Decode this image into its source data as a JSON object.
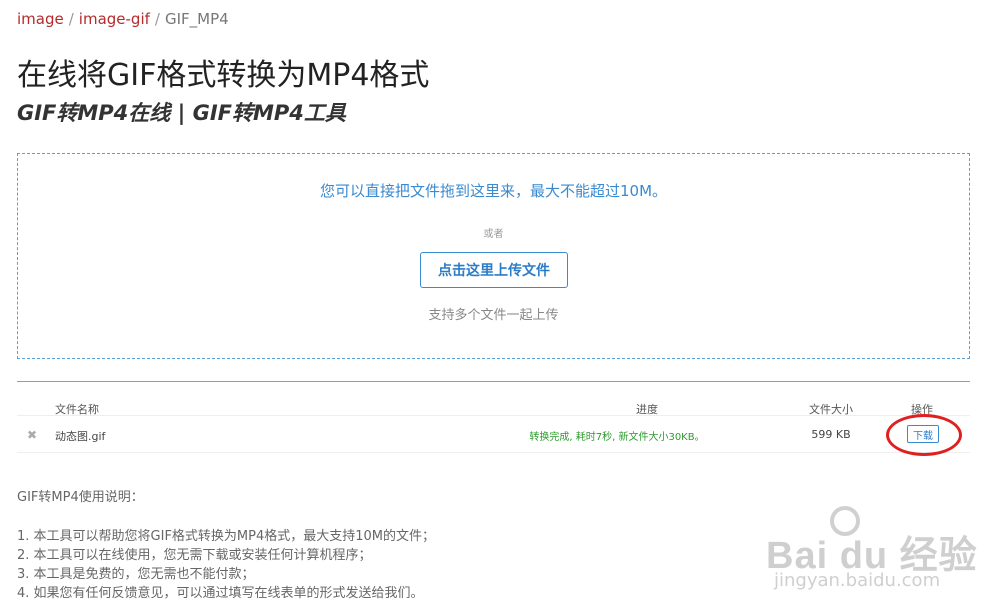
{
  "breadcrumb": {
    "items": [
      "image",
      "image-gif",
      "GIF_MP4"
    ],
    "separator": "/"
  },
  "page": {
    "title": "在线将GIF格式转换为MP4格式",
    "subtitle": "GIF转MP4在线 | GIF转MP4工具"
  },
  "dropzone": {
    "hint": "您可以直接把文件拖到这里来，最大不能超过10M。",
    "or_label": "或者",
    "upload_button": "点击这里上传文件",
    "multi_hint": "支持多个文件一起上传"
  },
  "file_table": {
    "columns": [
      "文件名称",
      "进度",
      "文件大小",
      "操作"
    ],
    "rows": [
      {
        "remove_icon": "✖",
        "name": "动态图.gif",
        "status": "转换完成, 耗时7秒, 新文件大小30KB。",
        "size": "599 KB",
        "action": "下载"
      }
    ]
  },
  "instructions": {
    "heading": "GIF转MP4使用说明：",
    "items": [
      "1. 本工具可以帮助您将GIF格式转换为MP4格式，最大支持10M的文件；",
      "2. 本工具可以在线使用，您无需下载或安装任何计算机程序；",
      "3. 本工具是免费的，您无需也不能付款；",
      "4. 如果您有任何反馈意见，可以通过填写在线表单的形式发送给我们。"
    ]
  },
  "watermark": {
    "brand": "Bai du 经验",
    "url": "jingyan.baidu.com"
  },
  "colors": {
    "accent_blue": "#3a8ad0",
    "breadcrumb_red": "#b52a2a",
    "success_green": "#2e9b2e",
    "annotation_red": "#e02020"
  }
}
